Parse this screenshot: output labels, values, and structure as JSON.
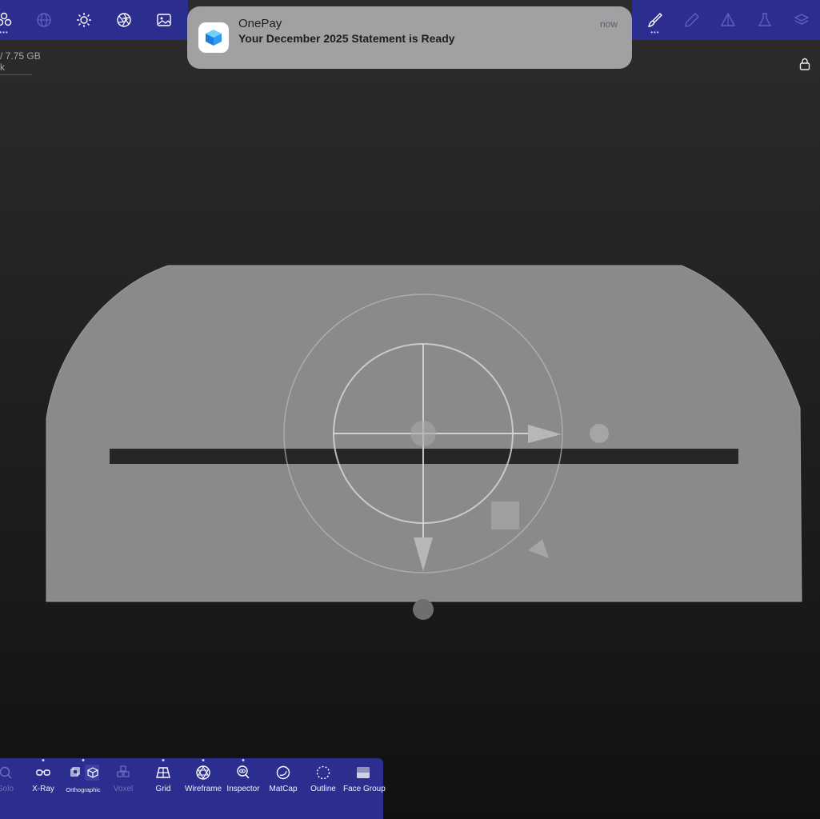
{
  "notification": {
    "app": "OnePay",
    "message": "Your December 2025 Statement is Ready",
    "time": "now"
  },
  "stats": {
    "memory": "7.75 GB",
    "line2": "k"
  },
  "top_left_icons": [
    "nodes-icon",
    "globe-icon",
    "sun-icon",
    "aperture-icon",
    "image-icon"
  ],
  "top_right_icons": [
    "brush-icon",
    "pen-icon",
    "prism-icon",
    "flask-icon",
    "layers-icon"
  ],
  "bottom_toolbar": [
    {
      "label": "Solo",
      "icon": "search-icon"
    },
    {
      "label": "X-Ray",
      "icon": "glasses-icon"
    },
    {
      "label": "Orthographic",
      "icon": "cube-icon"
    },
    {
      "label": "Voxel",
      "icon": "voxel-icon"
    },
    {
      "label": "Grid",
      "icon": "grid-icon"
    },
    {
      "label": "Wireframe",
      "icon": "wireframe-icon"
    },
    {
      "label": "Inspector",
      "icon": "inspector-icon"
    },
    {
      "label": "MatCap",
      "icon": "matcap-icon"
    },
    {
      "label": "Outline",
      "icon": "outline-icon"
    },
    {
      "label": "Face Group",
      "icon": "face-group-icon"
    }
  ],
  "colors": {
    "toolbar": "#2b2e8f",
    "model": "#888a8b",
    "slot": "#262626"
  }
}
